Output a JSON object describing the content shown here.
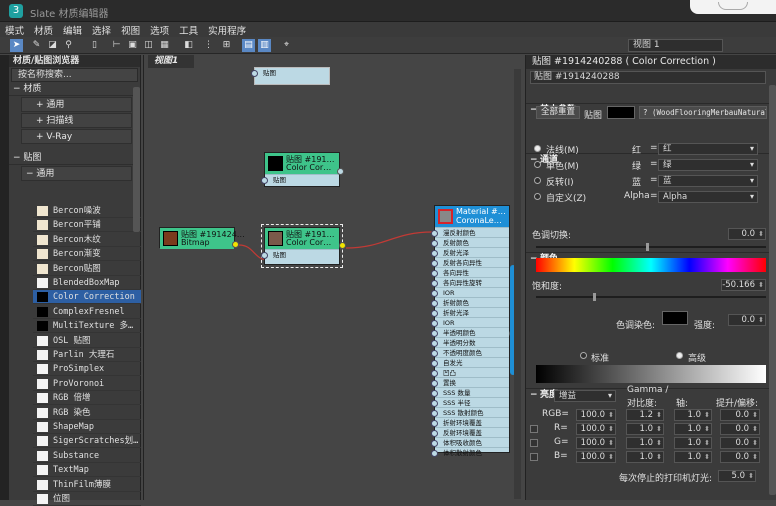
{
  "window": {
    "title": "Slate 材质编辑器"
  },
  "menu": [
    "模式",
    "材质",
    "编辑",
    "选择",
    "视图",
    "选项",
    "工具",
    "实用程序"
  ],
  "toolbar": {
    "view_select": "视图 1"
  },
  "browser": {
    "title": "材质/贴图浏览器",
    "search_placeholder": "按名称搜索...",
    "group_materials": "材质",
    "mat_items": [
      "+ 通用",
      "+ 扫描线",
      "+ V-Ray"
    ],
    "group_maps": "贴图",
    "map_sub": "通用",
    "maps": [
      "Bercon噪波",
      "Bercon平铺",
      "Bercon木纹",
      "Bercon渐变",
      "Bercon贴图",
      "BlendedBoxMap",
      "Color Correction",
      "ComplexFresnel",
      "MultiTexture 多…",
      "OSL 贴图",
      "Parlin 大理石",
      "ProSimplex",
      "ProVoronoi",
      "RGB 倍增",
      "RGB 染色",
      "ShapeMap",
      "SigerScratches划…",
      "Substance",
      "TextMap",
      "ThinFilm薄膜",
      "位图"
    ],
    "selected_map": "Color Correction"
  },
  "view": {
    "tab": "视图1"
  },
  "nodes": {
    "top": {
      "row": "贴图"
    },
    "cc1": {
      "t1": "贴图 #191…",
      "t2": "Color Cor…",
      "row": "贴图",
      "color": "#000000"
    },
    "bitmap": {
      "t1": "贴图 #191424…",
      "t2": "Bitmap",
      "color": "#7a3b1c"
    },
    "cc2": {
      "t1": "贴图 #191…",
      "t2": "Color Cor…",
      "row": "贴图",
      "color": "#7a5a4a"
    },
    "mat": {
      "t1": "Material #…",
      "t2": "CoronaLe…",
      "rows": [
        "漫反射颜色",
        "反射颜色",
        "反射光泽",
        "反射各向异性",
        "各向异性",
        "各向异性旋转",
        "IOR",
        "折射颜色",
        "折射光泽",
        "IOR",
        "半透明颜色",
        "半透明分数",
        "不透明度颜色",
        "自发光",
        "凹凸",
        "置换",
        "SSS 数量",
        "SSS 半径",
        "SSS 散射颜色",
        "折射环境覆盖",
        "反射环境覆盖",
        "体积吸收颜色",
        "体积散射颜色"
      ]
    }
  },
  "param": {
    "header": "贴图 #1914240288 ( Color Correction )",
    "name": "贴图 #1914240288",
    "basic": "基本参数",
    "reset": "全部重置",
    "map_label": "贴图",
    "map_name": "? (WoodFlooringMerbauNatural",
    "channels": "通道",
    "ch_opts": [
      "法线(M)",
      "单色(M)",
      "反转(I)",
      "自定义(Z)"
    ],
    "rgb": [
      {
        "l": "红",
        "v": "红"
      },
      {
        "l": "绿",
        "v": "绿"
      },
      {
        "l": "蓝",
        "v": "蓝"
      },
      {
        "l": "Alpha",
        "v": "Alpha"
      }
    ],
    "color": "颜色",
    "hue_shift": "色调切换:",
    "hue_val": "0.0",
    "saturation": "饱和度:",
    "sat_val": "-50.166",
    "tint": "色调染色:",
    "strength": "强度:",
    "strength_val": "0.0",
    "lightness": "亮度",
    "standard": "标准",
    "advanced": "高级",
    "mode": "增益",
    "gamma_h": "Gamma /",
    "contrast_h": "对比度:",
    "pivot_h": "轴:",
    "lift_h": "提升/偏移:",
    "rows": [
      {
        "l": "RGB=",
        "a": "100.0",
        "b": "1.2",
        "c": "1.0",
        "d": "0.0"
      },
      {
        "l": "R=",
        "a": "100.0",
        "b": "1.0",
        "c": "1.0",
        "d": "0.0"
      },
      {
        "l": "G=",
        "a": "100.0",
        "b": "1.0",
        "c": "1.0",
        "d": "0.0"
      },
      {
        "l": "B=",
        "a": "100.0",
        "b": "1.0",
        "c": "1.0",
        "d": "0.0"
      }
    ],
    "exposure": "每次停止的打印机灯光:",
    "exposure_val": "5.0"
  },
  "colors": {
    "accent": "#2d5fa3",
    "node_green": "#3ec48a",
    "node_blue": "#1e8fd6",
    "node_red": "#d6242a",
    "wire": "#c23a35"
  }
}
